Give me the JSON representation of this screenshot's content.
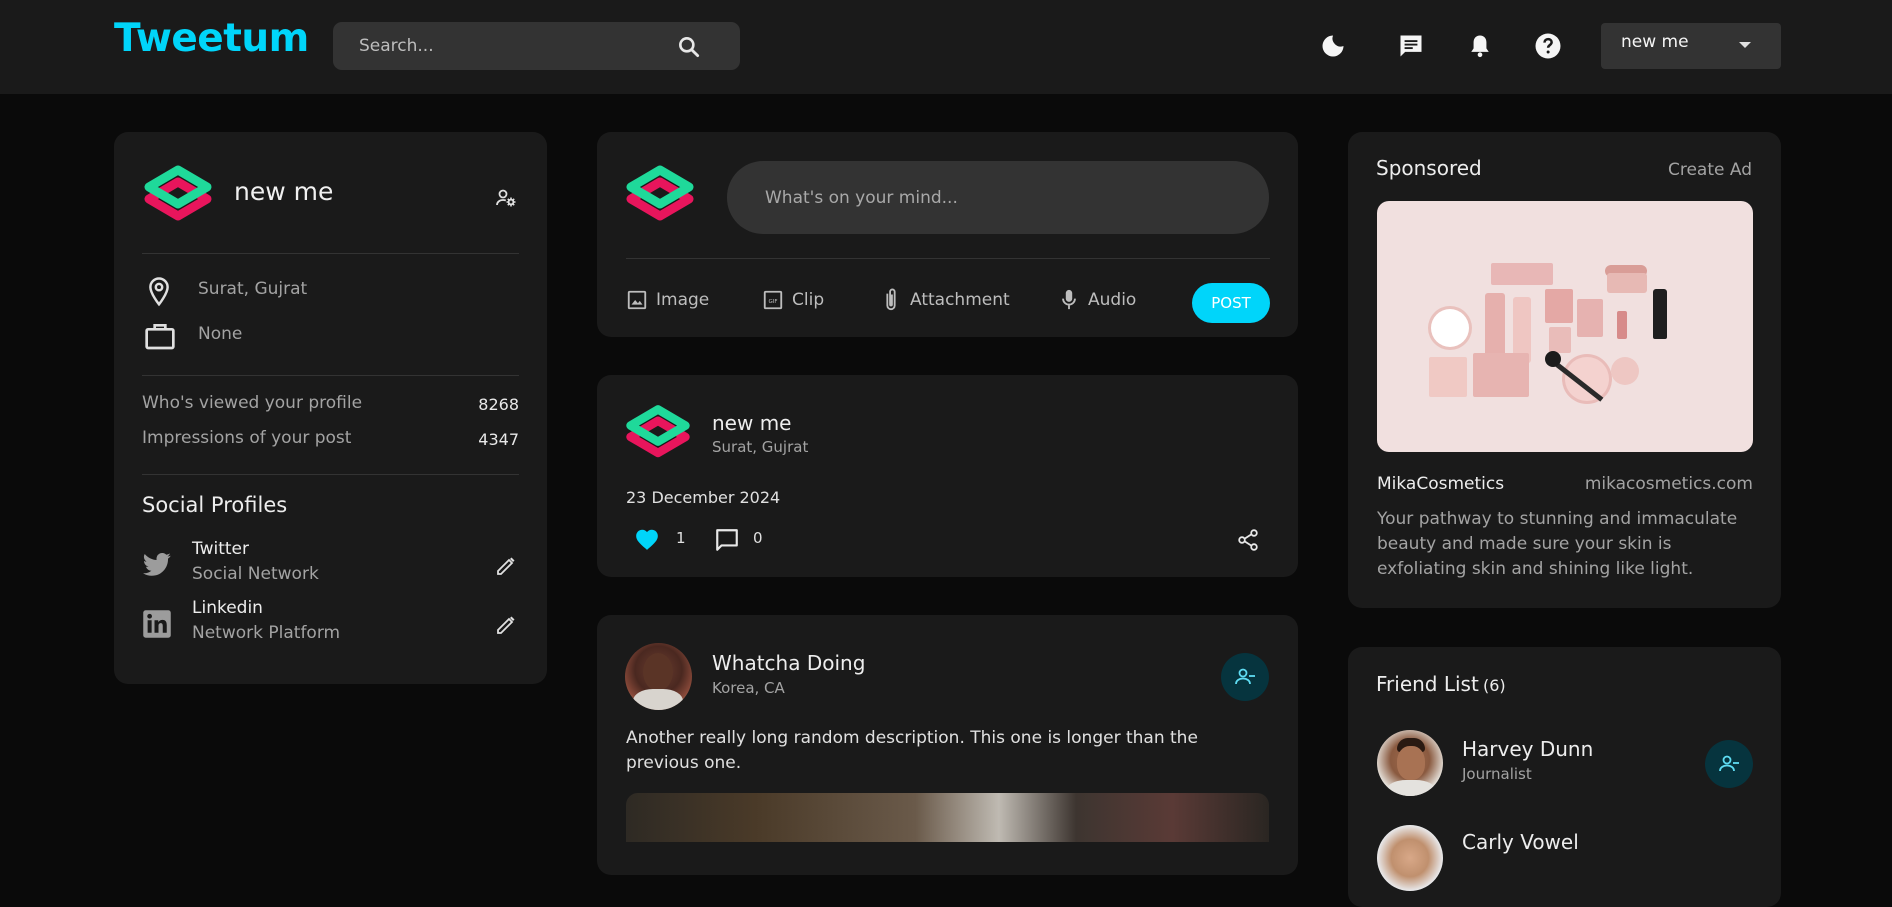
{
  "header": {
    "logo": "Tweetum",
    "search_placeholder": "Search...",
    "user_select_value": "new me"
  },
  "profile": {
    "name": "new me",
    "location": "Surat, Gujrat",
    "occupation": "None",
    "stats": [
      {
        "label": "Who's viewed your profile",
        "value": "8268"
      },
      {
        "label": "Impressions of your post",
        "value": "4347"
      }
    ],
    "social_title": "Social Profiles",
    "socials": [
      {
        "name": "Twitter",
        "type": "Social Network"
      },
      {
        "name": "Linkedin",
        "type": "Network Platform"
      }
    ]
  },
  "composer": {
    "placeholder": "What's on your mind...",
    "actions": [
      "Image",
      "Clip",
      "Attachment",
      "Audio"
    ],
    "post_label": "POST"
  },
  "post1": {
    "author": "new me",
    "location": "Surat, Gujrat",
    "date": "23 December 2024",
    "likes": "1",
    "comments": "0"
  },
  "post2": {
    "author": "Whatcha Doing",
    "location": "Korea, CA",
    "description": "Another really long random description. This one is longer than the previous one."
  },
  "sponsored": {
    "title": "Sponsored",
    "create_ad": "Create Ad",
    "brand": "MikaCosmetics",
    "url": "mikacosmetics.com",
    "description": "Your pathway to stunning and immaculate beauty and made sure your skin is exfoliating skin and shining like light."
  },
  "friends": {
    "title": "Friend List",
    "count": "(6)",
    "items": [
      {
        "name": "Harvey Dunn",
        "role": "Journalist"
      },
      {
        "name": "Carly Vowel",
        "role": ""
      }
    ]
  },
  "colors": {
    "accent": "#00d5fa",
    "card": "#1a1a1a",
    "background": "#0a0a0a",
    "input": "#333333"
  }
}
